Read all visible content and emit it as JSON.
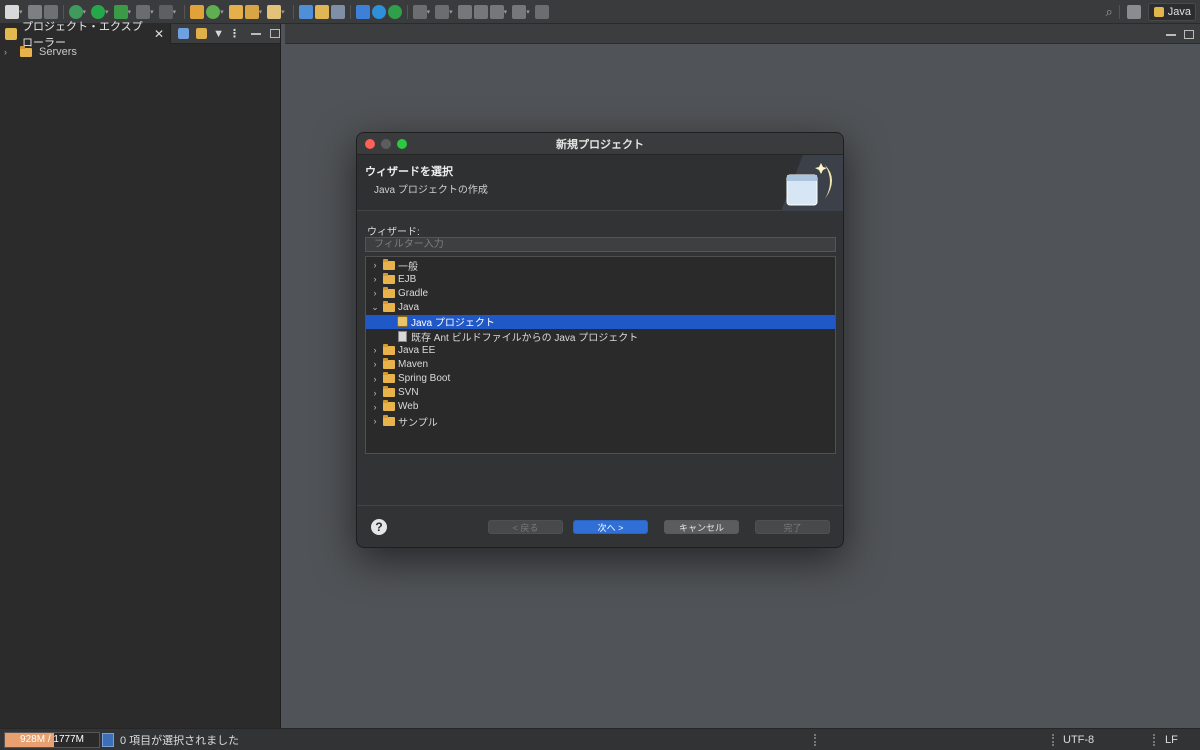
{
  "toolbar": {
    "icons": [
      "new-wizard-icon",
      "save-icon",
      "save-all-icon",
      "debug-icon",
      "run-icon",
      "run-external-icon",
      "stop-icon",
      "build-icon",
      "open-type-icon",
      "refresh-icon",
      "open-project-icon",
      "folder-icon",
      "brush-icon",
      "new-class-icon",
      "new-package-icon",
      "new-interface-icon",
      "task-icon",
      "gear-icon",
      "server-start-icon",
      "nav-icon",
      "back-nav-icon",
      "prev-edit-icon",
      "next-edit-icon",
      "back-icon",
      "forward-icon",
      "pin-icon"
    ],
    "perspective_label": "Java"
  },
  "left_view": {
    "tab_label": "プロジェクト・エクスプローラー",
    "tree": [
      {
        "label": "Servers"
      }
    ]
  },
  "dialog": {
    "title": "新規プロジェクト",
    "banner_title": "ウィザードを選択",
    "banner_description": "Java プロジェクトの作成",
    "wizard_label": "ウィザード:",
    "filter_placeholder": "フィルター入力",
    "tree": [
      {
        "label": "一般"
      },
      {
        "label": "EJB"
      },
      {
        "label": "Gradle"
      },
      {
        "label": "Java"
      },
      {
        "label": "Java プロジェクト"
      },
      {
        "label": "既存 Ant ビルドファイルからの Java プロジェクト"
      },
      {
        "label": "Java EE"
      },
      {
        "label": "Maven"
      },
      {
        "label": "Spring Boot"
      },
      {
        "label": "SVN"
      },
      {
        "label": "Web"
      },
      {
        "label": "サンプル"
      }
    ],
    "buttons": {
      "back": "< 戻る",
      "next": "次へ >",
      "cancel": "キャンセル",
      "finish": "完了"
    }
  },
  "status_bar": {
    "heap_used": "928M",
    "heap_total": "1777M",
    "heap_text": "928M / 1777M",
    "heap_fraction": 0.52,
    "selection_message": "0 項目が選択されました",
    "encoding": "UTF-8",
    "line_delimiter": "LF"
  },
  "colors": {
    "selection": "#2158c7",
    "primary_button": "#2f6fd6",
    "heap_fill": "#e8a070"
  }
}
